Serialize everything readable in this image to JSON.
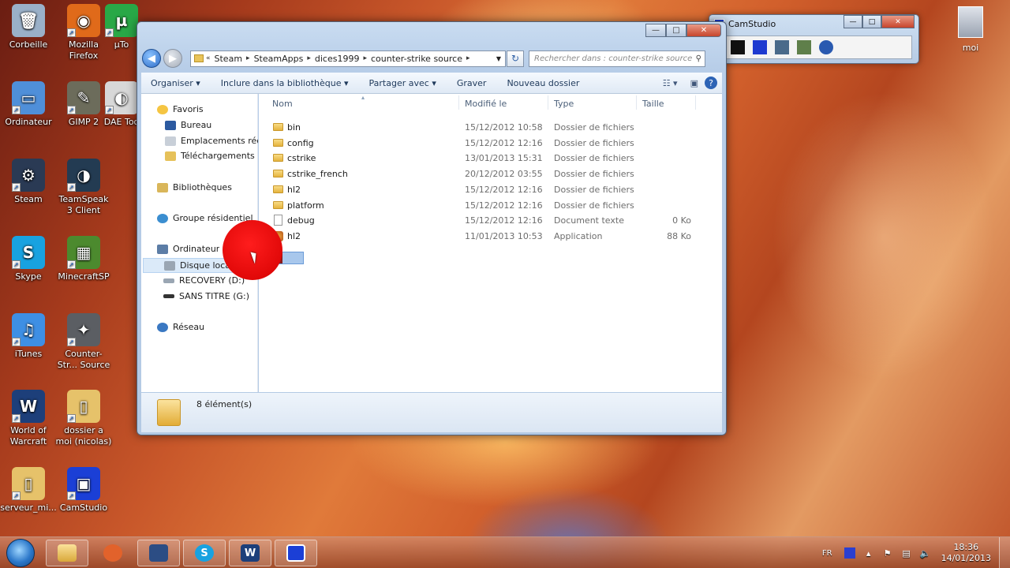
{
  "desktop": {
    "icons": [
      {
        "label": "Corbeille",
        "color": "#9ab0c8",
        "glyph": "🗑"
      },
      {
        "label": "Mozilla Firefox",
        "color": "#e06a1a",
        "glyph": "◉"
      },
      {
        "label": "µTo",
        "color": "#29a847",
        "glyph": "µ"
      },
      {
        "label": "Ordinateur",
        "color": "#4f8fd9",
        "glyph": "▭"
      },
      {
        "label": "GIMP 2",
        "color": "#6c6c5b",
        "glyph": "✎"
      },
      {
        "label": "DAE Too",
        "color": "#d8d8d8",
        "glyph": "◐"
      },
      {
        "label": "Steam",
        "color": "#2a3a54",
        "glyph": "⚙"
      },
      {
        "label": "TeamSpeak 3 Client",
        "color": "#233b52",
        "glyph": "◑"
      },
      {
        "label": "Skype",
        "color": "#18a2e0",
        "glyph": "S"
      },
      {
        "label": "MinecraftSP",
        "color": "#4c8a2e",
        "glyph": "▦"
      },
      {
        "label": "iTunes",
        "color": "#3e8fe4",
        "glyph": "♫"
      },
      {
        "label": "Counter-Str... Source",
        "color": "#5b5e63",
        "glyph": "✦"
      },
      {
        "label": "World of Warcraft",
        "color": "#1d3f7a",
        "glyph": "W"
      },
      {
        "label": "dossier a moi (nicolas)",
        "color": "#e6c26a",
        "glyph": "▯"
      },
      {
        "label": "serveur_mi...",
        "color": "#e6c26a",
        "glyph": "▯"
      },
      {
        "label": "CamStudio",
        "color": "#1b3fd6",
        "glyph": "▣"
      }
    ],
    "user_label": "moi"
  },
  "explorer": {
    "address": [
      "Steam",
      "SteamApps",
      "dices1999",
      "counter-strike source"
    ],
    "search_placeholder": "Rechercher dans : counter-strike source",
    "toolbar": {
      "organize": "Organiser",
      "include": "Inclure dans la bibliothèque",
      "share": "Partager avec",
      "burn": "Graver",
      "new_folder": "Nouveau dossier"
    },
    "nav": {
      "favorites": "Favoris",
      "desktop": "Bureau",
      "recent": "Emplacements récents",
      "downloads": "Téléchargements",
      "libraries": "Bibliothèques",
      "homegroup": "Groupe résidentiel",
      "computer": "Ordinateur",
      "disk_c": "Disque local (C:)",
      "disk_d": "RECOVERY (D:)",
      "disk_g": "SANS TITRE (G:)",
      "network": "Réseau"
    },
    "columns": {
      "name": "Nom",
      "modified": "Modifié le",
      "type": "Type",
      "size": "Taille"
    },
    "files": [
      {
        "name": "bin",
        "date": "15/12/2012 10:58",
        "type": "Dossier de fichiers",
        "size": "",
        "kind": "folder"
      },
      {
        "name": "config",
        "date": "15/12/2012 12:16",
        "type": "Dossier de fichiers",
        "size": "",
        "kind": "folder"
      },
      {
        "name": "cstrike",
        "date": "13/01/2013 15:31",
        "type": "Dossier de fichiers",
        "size": "",
        "kind": "folder"
      },
      {
        "name": "cstrike_french",
        "date": "20/12/2012 03:55",
        "type": "Dossier de fichiers",
        "size": "",
        "kind": "folder"
      },
      {
        "name": "hl2",
        "date": "15/12/2012 12:16",
        "type": "Dossier de fichiers",
        "size": "",
        "kind": "folder"
      },
      {
        "name": "platform",
        "date": "15/12/2012 12:16",
        "type": "Dossier de fichiers",
        "size": "",
        "kind": "folder"
      },
      {
        "name": "debug",
        "date": "15/12/2012 12:16",
        "type": "Document texte",
        "size": "0 Ko",
        "kind": "text"
      },
      {
        "name": "hl2",
        "date": "11/01/2013 10:53",
        "type": "Application",
        "size": "88 Ko",
        "kind": "app"
      }
    ],
    "status": "8 élément(s)"
  },
  "camstudio": {
    "title": "CamStudio"
  },
  "taskbar": {
    "language": "FR",
    "time": "18:36",
    "date": "14/01/2013"
  }
}
